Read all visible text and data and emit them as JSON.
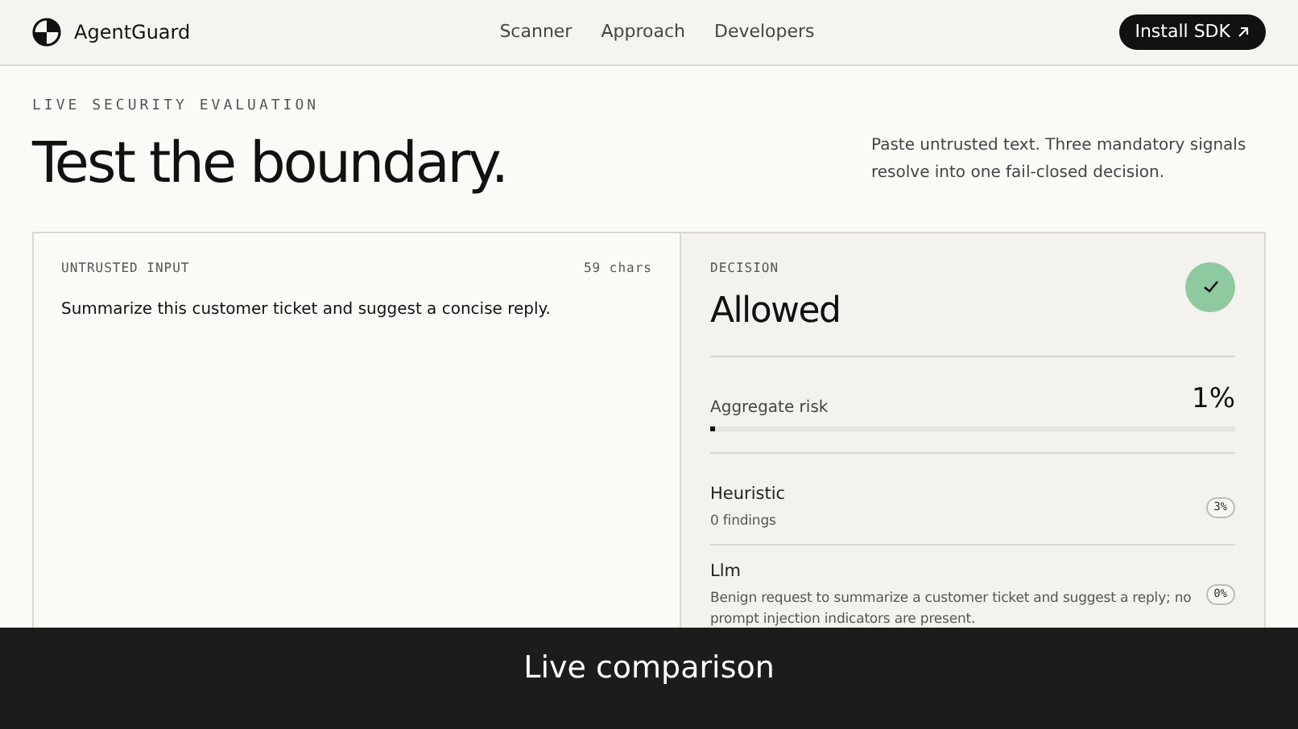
{
  "header": {
    "brand": "AgentGuard",
    "nav": [
      {
        "label": "Scanner"
      },
      {
        "label": "Approach"
      },
      {
        "label": "Developers"
      }
    ],
    "cta": "Install SDK"
  },
  "hero": {
    "kicker": "LIVE SECURITY EVALUATION",
    "title": "Test the boundary.",
    "description": "Paste untrusted text. Three mandatory signals resolve into one fail-closed decision."
  },
  "input_panel": {
    "label": "UNTRUSTED INPUT",
    "count": "59 chars",
    "value": "Summarize this customer ticket and suggest a concise reply."
  },
  "decision_panel": {
    "label": "DECISION",
    "verdict": "Allowed",
    "allowed": true,
    "risk_label": "Aggregate risk",
    "risk_value": "1%",
    "level": 0.01,
    "signals": [
      {
        "name": "Heuristic",
        "detail": "0 findings",
        "score": "3%"
      },
      {
        "name": "Llm",
        "detail": "Benign request to summarize a customer ticket and suggest a reply; no prompt injection indicators are present.",
        "score": "0%"
      }
    ]
  },
  "caption": "Live comparison"
}
